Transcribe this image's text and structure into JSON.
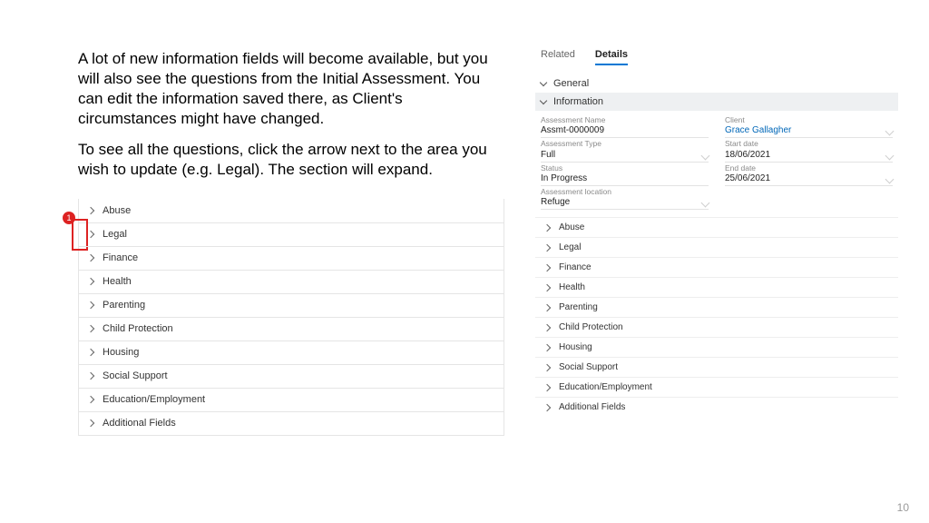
{
  "intro": {
    "p1": "A lot of new information fields will become available, but you will also see the questions from the Initial Assessment. You can edit the information saved there, as Client's circumstances might have changed.",
    "p2": "To see all the questions, click the arrow next to the area you wish to update (e.g. Legal). The section will expand."
  },
  "callout_number": "1",
  "left_sections": [
    "Abuse",
    "Legal",
    "Finance",
    "Health",
    "Parenting",
    "Child Protection",
    "Housing",
    "Social Support",
    "Education/Employment",
    "Additional Fields"
  ],
  "tabs": {
    "related": "Related",
    "details": "Details"
  },
  "right_headers": {
    "general": "General",
    "information": "Information"
  },
  "info_fields": {
    "assessment_name": {
      "label": "Assessment Name",
      "value": "Assmt-0000009"
    },
    "client": {
      "label": "Client",
      "value": "Grace Gallagher"
    },
    "assessment_type": {
      "label": "Assessment Type",
      "value": "Full"
    },
    "start_date": {
      "label": "Start date",
      "value": "18/06/2021"
    },
    "status": {
      "label": "Status",
      "value": "In Progress"
    },
    "end_date": {
      "label": "End date",
      "value": "25/06/2021"
    },
    "assessment_location": {
      "label": "Assessment location",
      "value": "Refuge"
    }
  },
  "right_sections": [
    "Abuse",
    "Legal",
    "Finance",
    "Health",
    "Parenting",
    "Child Protection",
    "Housing",
    "Social Support",
    "Education/Employment",
    "Additional Fields"
  ],
  "page_number": "10"
}
